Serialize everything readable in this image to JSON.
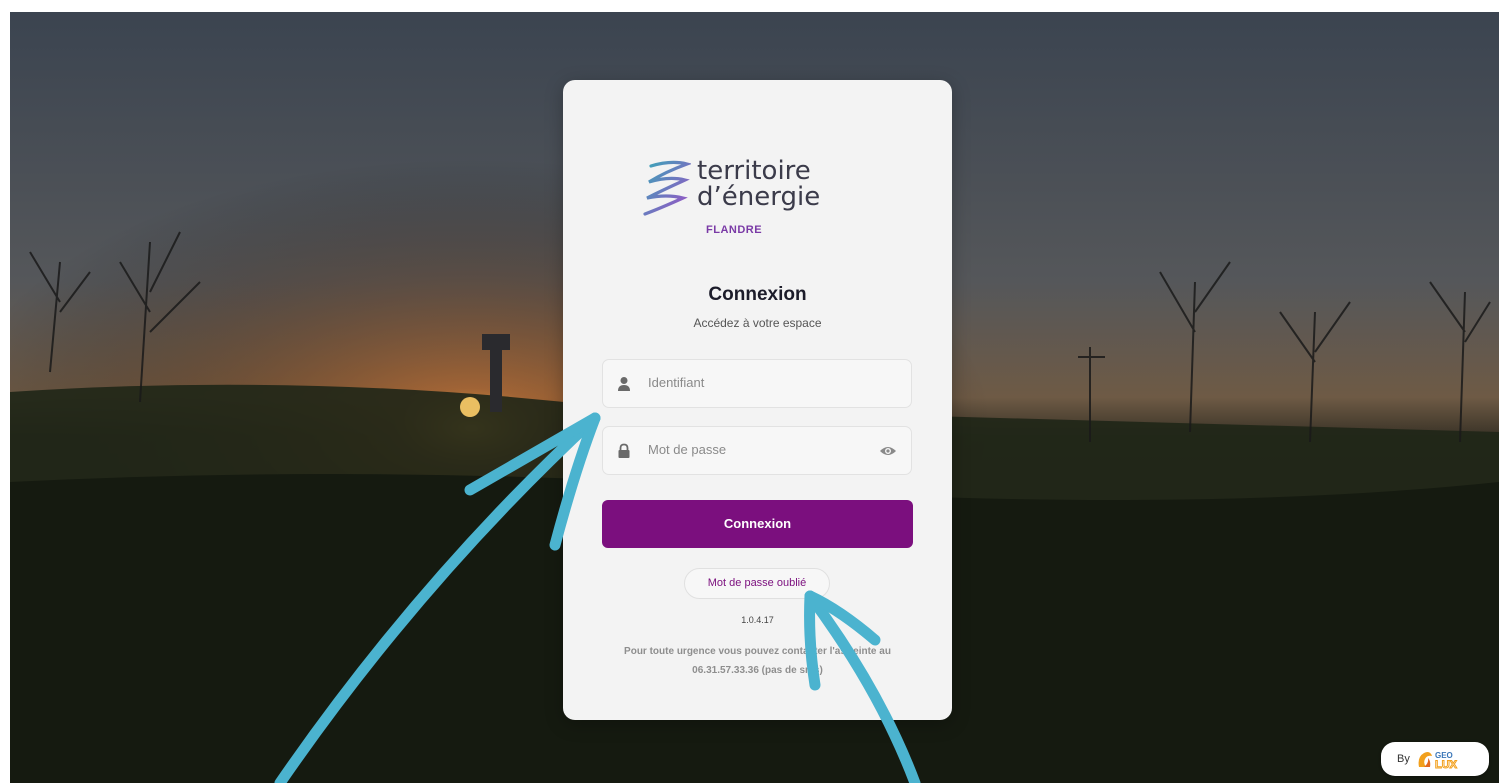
{
  "logo": {
    "line1": "territoire",
    "line2": "d’énergie",
    "sub": "FLANDRE"
  },
  "login": {
    "title": "Connexion",
    "subtitle": "Accédez à votre espace",
    "username_placeholder": "Identifiant",
    "password_placeholder": "Mot de passe",
    "submit_label": "Connexion",
    "forgot_label": "Mot de passe oublié",
    "version": "1.0.4.17",
    "urgence_text": "Pour toute urgence vous pouvez contacter l'astreinte au 06.31.57.33.36 (pas de sms)"
  },
  "footer_badge": {
    "by": "By",
    "brand_top": "GEO",
    "brand_bottom": "LUX"
  },
  "colors": {
    "primary": "#7b0f7e",
    "annotation_arrow": "#4bb3cf"
  }
}
